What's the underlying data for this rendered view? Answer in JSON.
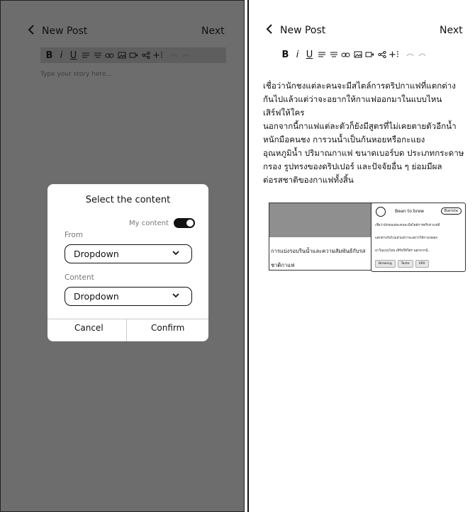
{
  "left": {
    "header": {
      "title": "New Post",
      "next_label": "Next"
    },
    "toolbar": {
      "bold": "B",
      "italic": "i",
      "underline": "U",
      "bullets": "⁼",
      "numbered": "⁼",
      "add_more": "+⁝"
    },
    "editor": {
      "placeholder": "Type your story here..."
    },
    "modal": {
      "title": "Select the content",
      "toggle_label": "My content",
      "toggle_on": true,
      "from_label": "From",
      "from_value": "Dropdown",
      "content_label": "Content",
      "content_value": "Dropdown",
      "cancel_label": "Cancel",
      "confirm_label": "Confirm"
    }
  },
  "right": {
    "header": {
      "title": "New Post",
      "next_label": "Next"
    },
    "toolbar": {
      "bold": "B",
      "italic": "i",
      "underline": "U",
      "add_more": "+⁝"
    },
    "story": [
      "เชื่อว่านักชงแต่ละคนจะมีสไตล์การดริปกาแฟที่แตกต่าง",
      "กันไปแล้วแต่ว่าจะอยากให้กาแฟออกมาในแบบไหน",
      "เสิร์ฟให้ใคร",
      "นอกจากนี้กาแฟแต่ละตัวก็ยังมีสูตรที่ไม่เคยตายตัวอีกน้ำ",
      "หนักมือคนชง การวนน้ำเป็นก้นหอยหรือกะแยง",
      "อุณหภูมิน้ำ ปริมาณกาแฟ ขนาดเบอร์บด ประเภทกระดาษ",
      "กรอง รูปทรงของดริปเปอร์ และปัจจัยอื่น ๆ ย่อมมีผล",
      "ต่อรสชาติของกาแฟทั้งสิ้น"
    ],
    "card_article": {
      "caption_line1": "การแบ่งรอบรินน้ำและความสัมพันธ์กับรส",
      "caption_line2": "ชาติกาแฟ"
    },
    "card_profile": {
      "name": "Bean to brew",
      "badge": "Barista",
      "lines": [
        "เชื่อว่านักชงแต่ละคนจะมีสไตล์การดริปกาแฟที่",
        "แตกต่างกันไปแล้วแต่ว่าจะอยากให้กาแฟออก",
        "มาในแบบไหน เสิร์ฟให้ใคร นอกจากนี้..."
      ],
      "tags": [
        "Brewing",
        "Taste",
        "V60"
      ]
    }
  }
}
